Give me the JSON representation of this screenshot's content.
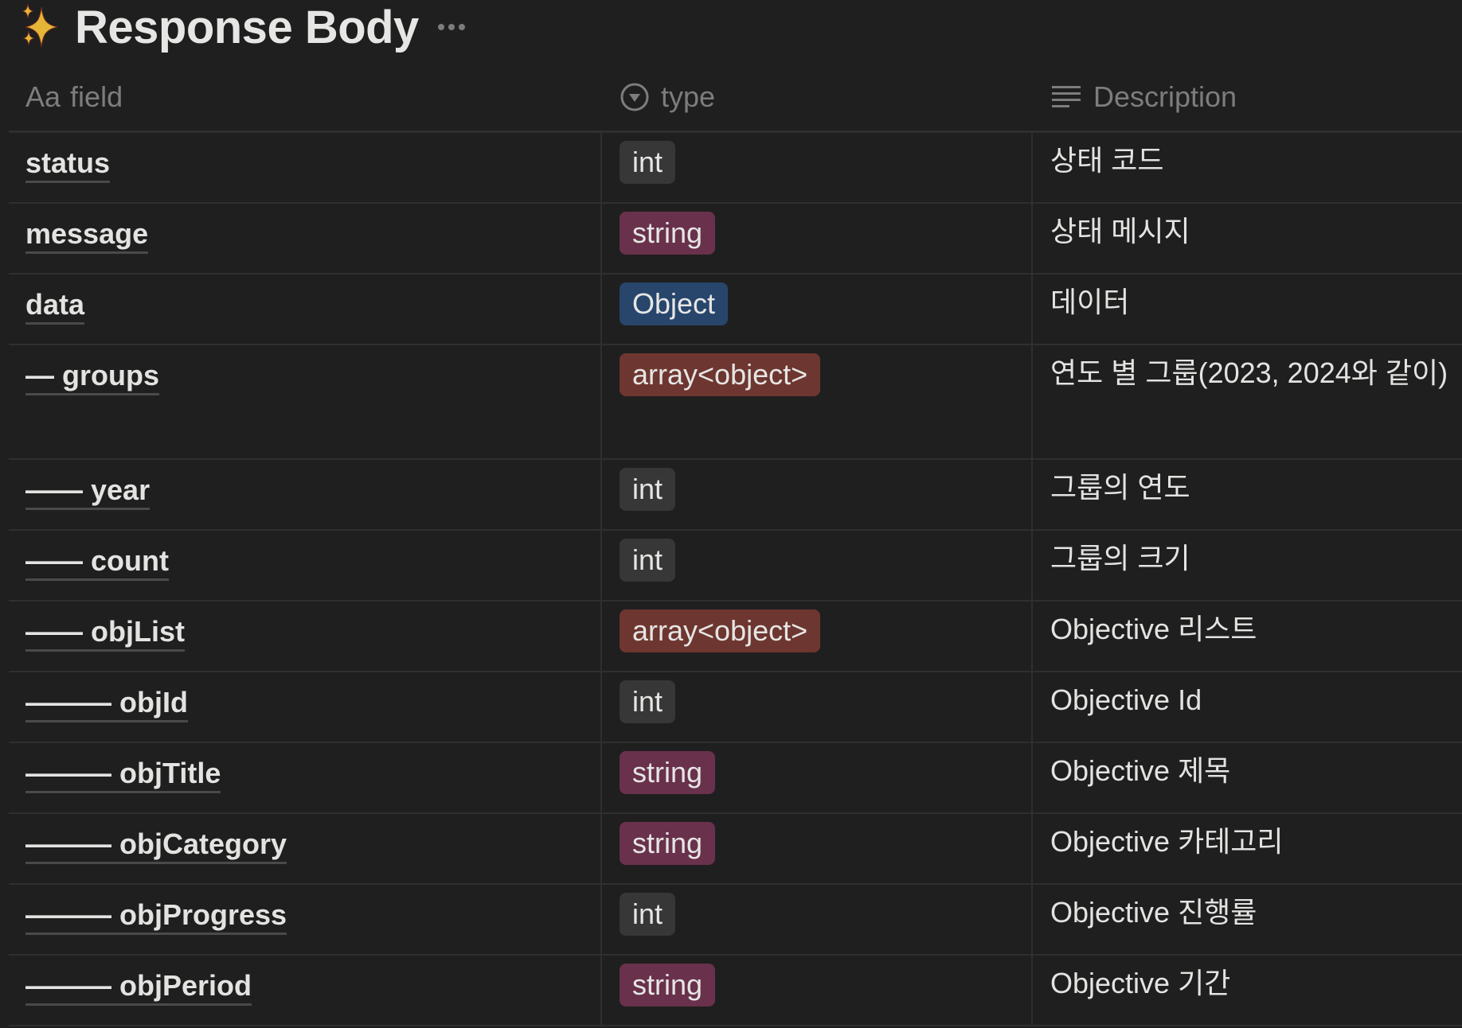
{
  "title": {
    "icon": "sparkles-icon",
    "text": "Response Body",
    "more_icon": "more-horizontal-icon"
  },
  "columns": [
    {
      "key": "field",
      "label": "field",
      "icon": "Aa",
      "icon_name": "text-property-icon"
    },
    {
      "key": "type",
      "label": "type",
      "icon": "▾",
      "icon_name": "select-property-icon"
    },
    {
      "key": "description",
      "label": "Description",
      "icon": "≡",
      "icon_name": "text-lines-icon"
    }
  ],
  "type_colors": {
    "int": "#373737",
    "string": "#69314c",
    "Object": "#28456c",
    "array<object>": "#6e3630"
  },
  "rows": [
    {
      "field": "status",
      "type": "int",
      "description": "상태 코드"
    },
    {
      "field": "message",
      "type": "string",
      "description": "상태 메시지"
    },
    {
      "field": "data",
      "type": "Object",
      "description": "데이터"
    },
    {
      "field": "— groups",
      "type": "array<object>",
      "description": "연도 별 그룹(2023, 2024와 같이)"
    },
    {
      "field": "—— year",
      "type": "int",
      "description": "그룹의 연도"
    },
    {
      "field": "—— count",
      "type": "int",
      "description": "그룹의 크기"
    },
    {
      "field": "—— objList",
      "type": "array<object>",
      "description": "Objective 리스트"
    },
    {
      "field": "——— objId",
      "type": "int",
      "description": "Objective Id"
    },
    {
      "field": "——— objTitle",
      "type": "string",
      "description": "Objective 제목"
    },
    {
      "field": "——— objCategory",
      "type": "string",
      "description": "Objective 카테고리"
    },
    {
      "field": "——— objProgress",
      "type": "int",
      "description": "Objective 진행률"
    },
    {
      "field": "——— objPeriod",
      "type": "string",
      "description": "Objective 기간"
    }
  ]
}
